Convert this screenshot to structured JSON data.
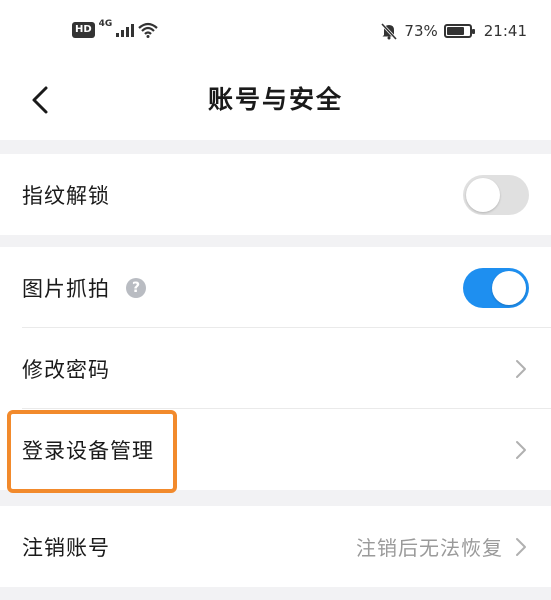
{
  "status_bar": {
    "hd": "HD",
    "network": "4G",
    "battery_percent": "73%",
    "battery_level": 0.73,
    "time": "21:41",
    "icons": [
      "hd-icon",
      "signal-icon",
      "wifi-icon",
      "bell-muted-icon",
      "battery-icon"
    ]
  },
  "header": {
    "title": "账号与安全",
    "back_icon": "chevron-left-icon"
  },
  "settings": {
    "fingerprint_unlock": {
      "label": "指纹解锁",
      "enabled": false
    },
    "photo_capture": {
      "label": "图片抓拍",
      "enabled": true,
      "help_icon": "?"
    },
    "change_password": {
      "label": "修改密码"
    },
    "device_management": {
      "label": "登录设备管理"
    },
    "cancel_account": {
      "label": "注销账号",
      "value": "注销后无法恢复"
    }
  },
  "colors": {
    "accent": "#1e8ff0",
    "highlight": "#f28a2c",
    "background": "#f2f2f4"
  }
}
